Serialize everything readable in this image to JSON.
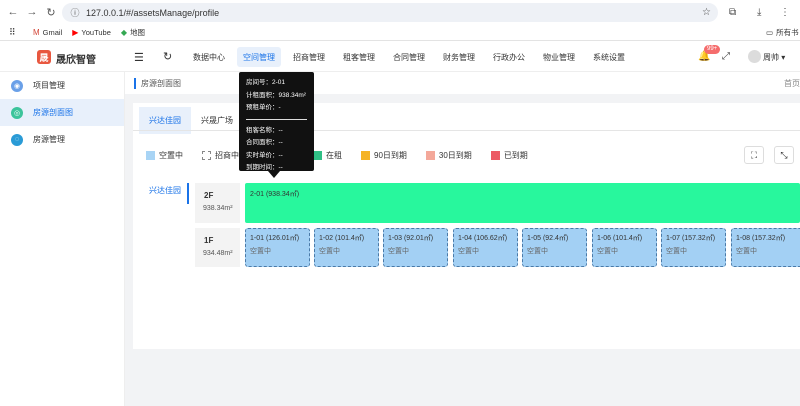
{
  "browser": {
    "url": "127.0.0.1/#/assetsManage/profile",
    "bookmarks": [
      {
        "label": "Gmail",
        "icon": "gmail-icon"
      },
      {
        "label": "YouTube",
        "icon": "youtube-icon"
      },
      {
        "label": "地图",
        "icon": "maps-icon"
      }
    ],
    "all_bookmarks_label": "所有书"
  },
  "app": {
    "brand": "晟欣智管",
    "topnav": [
      "数据中心",
      "空间管理",
      "招商管理",
      "租客管理",
      "合同管理",
      "财务管理",
      "行政办公",
      "物业管理",
      "系统设置"
    ],
    "active_nav": "空间管理",
    "notification_count": "99+",
    "user": "周帅"
  },
  "sidebar": {
    "items": [
      {
        "label": "项目管理",
        "color": "#6aa0e8"
      },
      {
        "label": "房源剖面图",
        "color": "#3cc49b"
      },
      {
        "label": "房源管理",
        "color": "#2a9bd6"
      }
    ],
    "active_index": 1
  },
  "page": {
    "breadcrumb": "房源剖面图",
    "breadcrumb_right": "首页",
    "tabs": [
      "兴达佳园",
      "兴晟广场"
    ],
    "active_tab": 0,
    "legend": [
      {
        "label": "空置中",
        "color": "#a8d4f5",
        "dashed": false
      },
      {
        "label": "招商中",
        "color": "#ffffff",
        "dashed": true
      },
      {
        "label": "在租",
        "color": "#2fbf85",
        "dashed": false
      },
      {
        "label": "90日到期",
        "color": "#f5b324",
        "dashed": false
      },
      {
        "label": "30日到期",
        "color": "#f4a89a",
        "dashed": false
      },
      {
        "label": "已到期",
        "color": "#ec5a64",
        "dashed": false
      }
    ],
    "building": "兴达佳园",
    "floors": [
      {
        "name": "2F",
        "area": "938.34m²"
      },
      {
        "name": "1F",
        "area": "934.48m²"
      }
    ],
    "rented_room": "2-01 (938.34㎡)",
    "rooms_1f": [
      {
        "name": "1-01 (126.01㎡)",
        "status": "空置中"
      },
      {
        "name": "1-02 (101.4㎡)",
        "status": "空置中"
      },
      {
        "name": "1-03 (92.01㎡)",
        "status": "空置中"
      },
      {
        "name": "1-04 (106.62㎡)",
        "status": "空置中"
      },
      {
        "name": "1-05 (92.4㎡)",
        "status": "空置中"
      },
      {
        "name": "1-06 (101.4㎡)",
        "status": "空置中"
      },
      {
        "name": "1-07 (157.32㎡)",
        "status": "空置中"
      },
      {
        "name": "1-08 (157.32㎡)",
        "status": "空置中"
      }
    ]
  },
  "tooltip": {
    "lines_top": [
      "房间号：2-01",
      "计租面积：938.34m²",
      "预租单价：-"
    ],
    "lines_bottom": [
      "租客名称：--",
      "合同面积：--",
      "实时单价：--",
      "到期时间：--"
    ]
  }
}
